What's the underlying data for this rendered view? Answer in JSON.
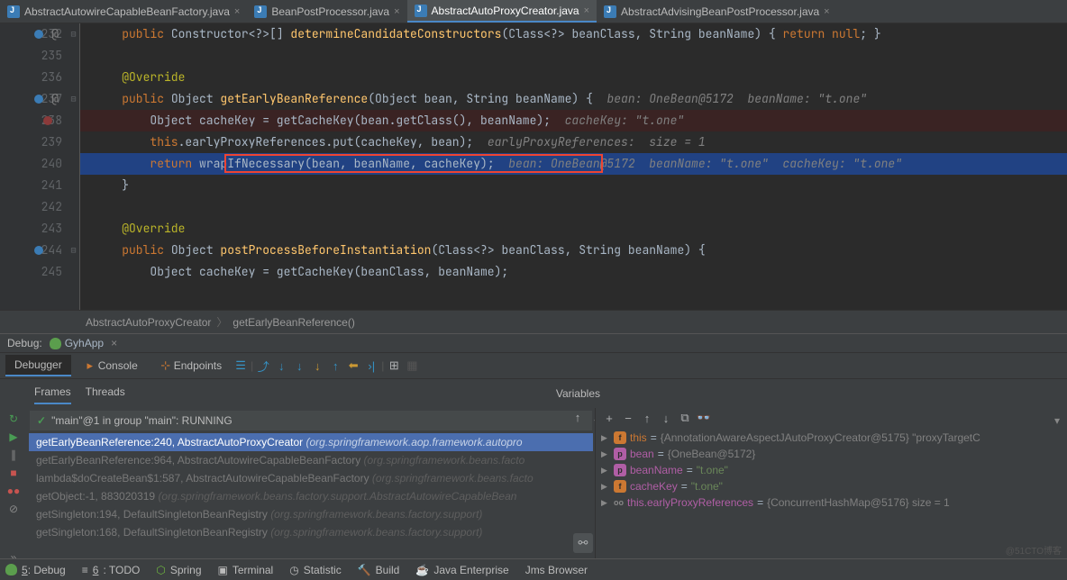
{
  "tabs": [
    {
      "name": "AbstractAutowireCapableBeanFactory.java",
      "active": false
    },
    {
      "name": "BeanPostProcessor.java",
      "active": false
    },
    {
      "name": "AbstractAutoProxyCreator.java",
      "active": true
    },
    {
      "name": "AbstractAdvisingBeanPostProcessor.java",
      "active": false
    }
  ],
  "lines": [
    "232",
    "235",
    "236",
    "237",
    "238",
    "239",
    "240",
    "241",
    "242",
    "243",
    "244",
    "245"
  ],
  "code": {
    "l232_a": "public",
    "l232_b": " Constructor<?>[] ",
    "l232_c": "determineCandidateConstructors",
    "l232_d": "(Class<?> beanClass, String beanName) { ",
    "l232_e": "return null",
    "l232_f": "; }",
    "l236": "@Override",
    "l237_a": "public",
    "l237_b": " Object ",
    "l237_c": "getEarlyBeanReference",
    "l237_d": "(Object bean, String beanName) {  ",
    "l237_e": "bean: OneBean@5172  beanName: \"t.one\"",
    "l238_a": "Object cacheKey = getCacheKey(bean.getClass(), beanName);  ",
    "l238_b": "cacheKey: \"t.one\"",
    "l239_a": "this",
    "l239_b": ".earlyProxyReferences.put(cacheKey, bean);  ",
    "l239_c": "earlyProxyReferences:  size = 1",
    "l240_a": "return",
    "l240_b": " wrapIfNecessary(bean, beanName, cacheKey);  ",
    "l240_c": "bean: OneBean@5172  beanName: \"t.one\"  cacheKey: \"t.one\"",
    "l241": "}",
    "l243": "@Override",
    "l244_a": "public",
    "l244_b": " Object ",
    "l244_c": "postProcessBeforeInstantiation",
    "l244_d": "(Class<?> beanClass, String beanName) {",
    "l245": "Object cacheKey = getCacheKey(beanClass, beanName);"
  },
  "breadcrumb": {
    "a": "AbstractAutoProxyCreator",
    "b": "getEarlyBeanReference()"
  },
  "debug": {
    "label": "Debug:",
    "app": "GyhApp"
  },
  "dbgtabs": {
    "debugger": "Debugger",
    "console": "Console",
    "endpoints": "Endpoints"
  },
  "frames": {
    "tab1": "Frames",
    "tab2": "Threads",
    "selector": "\"main\"@1 in group \"main\": RUNNING"
  },
  "stack": [
    {
      "m": "getEarlyBeanReference:240, AbstractAutoProxyCreator ",
      "p": "(org.springframework.aop.framework.autopro",
      "sel": true
    },
    {
      "m": "getEarlyBeanReference:964, AbstractAutowireCapableBeanFactory ",
      "p": "(org.springframework.beans.facto",
      "sel": false
    },
    {
      "m": "lambda$doCreateBean$1:587, AbstractAutowireCapableBeanFactory ",
      "p": "(org.springframework.beans.facto",
      "sel": false
    },
    {
      "m": "getObject:-1, 883020319 ",
      "p": "(org.springframework.beans.factory.support.AbstractAutowireCapableBean",
      "sel": false
    },
    {
      "m": "getSingleton:194, DefaultSingletonBeanRegistry ",
      "p": "(org.springframework.beans.factory.support)",
      "sel": false
    },
    {
      "m": "getSingleton:168, DefaultSingletonBeanRegistry ",
      "p": "(org.springframework.beans.factory.support)",
      "sel": false
    }
  ],
  "vars": {
    "hdr": "Variables"
  },
  "varlist": [
    {
      "icon": "f",
      "cls": "",
      "name": "this",
      "ncls": "this",
      "val": "{AnnotationAwareAspectJAutoProxyCreator@5175} \"proxyTargetC",
      "vcls": ""
    },
    {
      "icon": "p",
      "cls": "p",
      "name": "bean",
      "ncls": "",
      "val": "{OneBean@5172}",
      "vcls": ""
    },
    {
      "icon": "p",
      "cls": "p",
      "name": "beanName",
      "ncls": "",
      "val": "\"t.one\"",
      "vcls": "str"
    },
    {
      "icon": "f",
      "cls": "",
      "name": "cacheKey",
      "ncls": "",
      "val": "\"t.one\"",
      "vcls": "str"
    },
    {
      "icon": "oo",
      "cls": "oo",
      "name": "this.earlyProxyReferences",
      "ncls": "",
      "val": "{ConcurrentHashMap@5176}  size = 1",
      "vcls": ""
    }
  ],
  "status": {
    "debug": "5: Debug",
    "todo": "6: TODO",
    "spring": "Spring",
    "terminal": "Terminal",
    "statistic": "Statistic",
    "build": "Build",
    "java": "Java Enterprise",
    "jms": "Jms Browser"
  },
  "watermark": "@51CTO博客"
}
